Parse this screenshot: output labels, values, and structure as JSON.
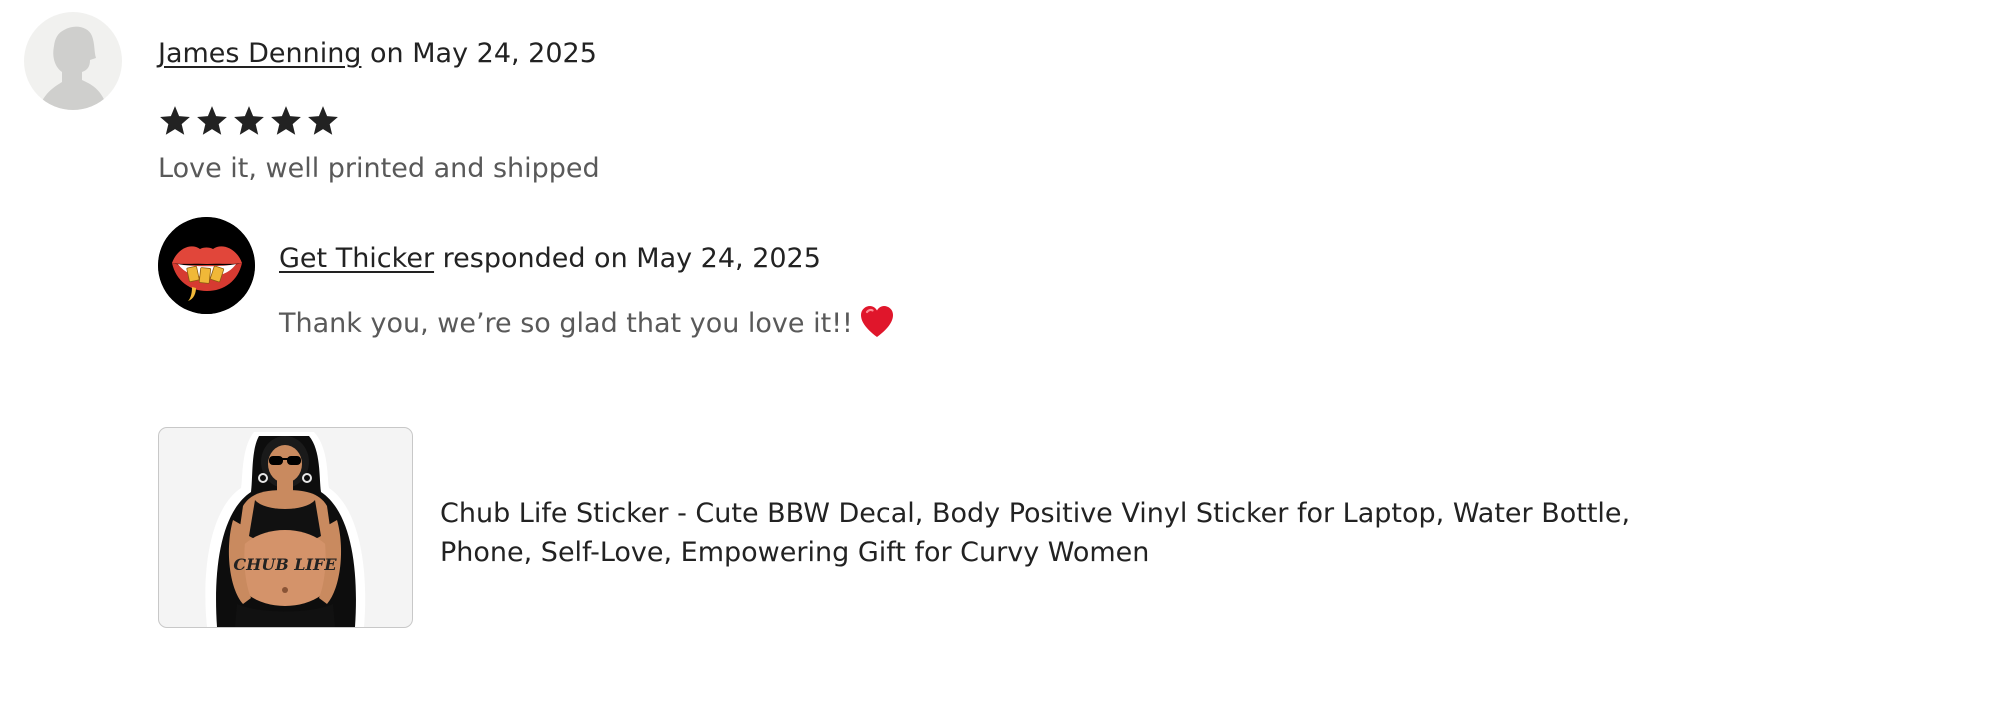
{
  "review": {
    "reviewer_name": "James Denning",
    "date_text": " on May 24, 2025",
    "rating": 5,
    "rating_max": 5,
    "text": "Love it, well printed and shipped"
  },
  "response": {
    "shop_name": "Get Thicker",
    "date_text": " responded on May 24, 2025",
    "text": "Thank you, we’re so glad that you love it!!",
    "emoji_icon": "red-heart-icon"
  },
  "product": {
    "title": "Chub Life Sticker - Cute BBW Decal, Body Positive Vinyl Sticker for Laptop, Water Bottle, Phone, Self-Love, Empowering Gift for Curvy Women",
    "sticker_text": "CHUB LIFE"
  },
  "colors": {
    "text": "#222222",
    "muted_text": "#595959",
    "star": "#222222",
    "heart": "#e0162b"
  }
}
